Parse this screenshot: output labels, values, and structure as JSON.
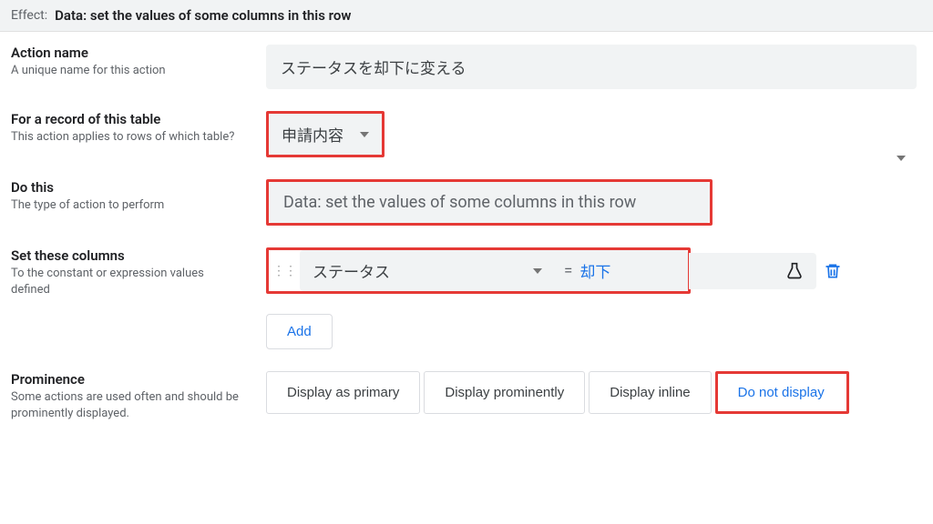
{
  "header": {
    "label": "Effect:",
    "value": "Data: set the values of some columns in this row"
  },
  "fields": {
    "action_name": {
      "label": "Action name",
      "sub": "A unique name for this action",
      "value": "ステータスを却下に変える"
    },
    "table": {
      "label": "For a record of this table",
      "sub": "This action applies to rows of which table?",
      "value": "申請内容"
    },
    "do_this": {
      "label": "Do this",
      "sub": "The type of action to perform",
      "value": "Data: set the values of some columns in this row"
    },
    "set_cols": {
      "label": "Set these columns",
      "sub": "To the constant or expression values defined",
      "column": "ステータス",
      "eq": "=",
      "colvalue": "却下",
      "add": "Add"
    },
    "prominence": {
      "label": "Prominence",
      "sub": "Some actions are used often and should be prominently displayed.",
      "opts": [
        "Display as primary",
        "Display prominently",
        "Display inline",
        "Do not display"
      ]
    }
  }
}
